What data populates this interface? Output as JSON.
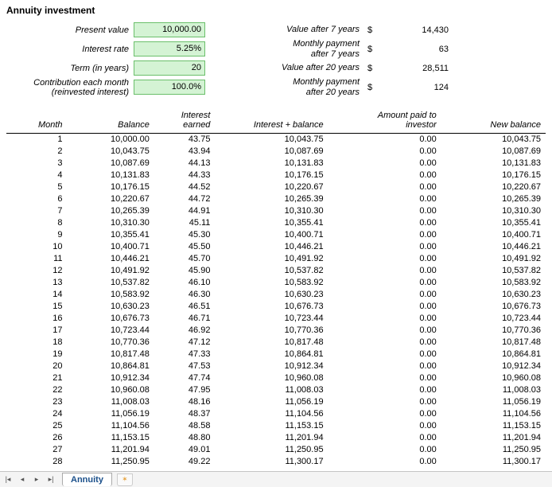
{
  "title": "Annuity investment",
  "inputs": {
    "present_value_label": "Present value",
    "present_value": "10,000.00",
    "interest_rate_label": "Interest rate",
    "interest_rate": "5.25%",
    "term_label": "Term (in years)",
    "term": "20",
    "contribution_line1": "Contribution each month",
    "contribution_line2": "(reinvested interest)",
    "contribution": "100.0%"
  },
  "outputs": {
    "value7_label": "Value after 7 years",
    "value7_cur": "$",
    "value7": "14,430",
    "pay7_line1": "Monthly payment",
    "pay7_line2": "after 7 years",
    "pay7_cur": "$",
    "pay7": "63",
    "value20_label": "Value after 20 years",
    "value20_cur": "$",
    "value20": "28,511",
    "pay20_line1": "Monthly payment",
    "pay20_line2": "after 20 years",
    "pay20_cur": "$",
    "pay20": "124"
  },
  "headers": {
    "month": "Month",
    "balance": "Balance",
    "interest_earned": "Interest earned",
    "interest_balance": "Interest + balance",
    "amount_paid": "Amount paid to investor",
    "new_balance": "New balance"
  },
  "rows": [
    {
      "m": "1",
      "b": "10,000.00",
      "ie": "43.75",
      "ib": "10,043.75",
      "ap": "0.00",
      "nb": "10,043.75"
    },
    {
      "m": "2",
      "b": "10,043.75",
      "ie": "43.94",
      "ib": "10,087.69",
      "ap": "0.00",
      "nb": "10,087.69"
    },
    {
      "m": "3",
      "b": "10,087.69",
      "ie": "44.13",
      "ib": "10,131.83",
      "ap": "0.00",
      "nb": "10,131.83"
    },
    {
      "m": "4",
      "b": "10,131.83",
      "ie": "44.33",
      "ib": "10,176.15",
      "ap": "0.00",
      "nb": "10,176.15"
    },
    {
      "m": "5",
      "b": "10,176.15",
      "ie": "44.52",
      "ib": "10,220.67",
      "ap": "0.00",
      "nb": "10,220.67"
    },
    {
      "m": "6",
      "b": "10,220.67",
      "ie": "44.72",
      "ib": "10,265.39",
      "ap": "0.00",
      "nb": "10,265.39"
    },
    {
      "m": "7",
      "b": "10,265.39",
      "ie": "44.91",
      "ib": "10,310.30",
      "ap": "0.00",
      "nb": "10,310.30"
    },
    {
      "m": "8",
      "b": "10,310.30",
      "ie": "45.11",
      "ib": "10,355.41",
      "ap": "0.00",
      "nb": "10,355.41"
    },
    {
      "m": "9",
      "b": "10,355.41",
      "ie": "45.30",
      "ib": "10,400.71",
      "ap": "0.00",
      "nb": "10,400.71"
    },
    {
      "m": "10",
      "b": "10,400.71",
      "ie": "45.50",
      "ib": "10,446.21",
      "ap": "0.00",
      "nb": "10,446.21"
    },
    {
      "m": "11",
      "b": "10,446.21",
      "ie": "45.70",
      "ib": "10,491.92",
      "ap": "0.00",
      "nb": "10,491.92"
    },
    {
      "m": "12",
      "b": "10,491.92",
      "ie": "45.90",
      "ib": "10,537.82",
      "ap": "0.00",
      "nb": "10,537.82"
    },
    {
      "m": "13",
      "b": "10,537.82",
      "ie": "46.10",
      "ib": "10,583.92",
      "ap": "0.00",
      "nb": "10,583.92"
    },
    {
      "m": "14",
      "b": "10,583.92",
      "ie": "46.30",
      "ib": "10,630.23",
      "ap": "0.00",
      "nb": "10,630.23"
    },
    {
      "m": "15",
      "b": "10,630.23",
      "ie": "46.51",
      "ib": "10,676.73",
      "ap": "0.00",
      "nb": "10,676.73"
    },
    {
      "m": "16",
      "b": "10,676.73",
      "ie": "46.71",
      "ib": "10,723.44",
      "ap": "0.00",
      "nb": "10,723.44"
    },
    {
      "m": "17",
      "b": "10,723.44",
      "ie": "46.92",
      "ib": "10,770.36",
      "ap": "0.00",
      "nb": "10,770.36"
    },
    {
      "m": "18",
      "b": "10,770.36",
      "ie": "47.12",
      "ib": "10,817.48",
      "ap": "0.00",
      "nb": "10,817.48"
    },
    {
      "m": "19",
      "b": "10,817.48",
      "ie": "47.33",
      "ib": "10,864.81",
      "ap": "0.00",
      "nb": "10,864.81"
    },
    {
      "m": "20",
      "b": "10,864.81",
      "ie": "47.53",
      "ib": "10,912.34",
      "ap": "0.00",
      "nb": "10,912.34"
    },
    {
      "m": "21",
      "b": "10,912.34",
      "ie": "47.74",
      "ib": "10,960.08",
      "ap": "0.00",
      "nb": "10,960.08"
    },
    {
      "m": "22",
      "b": "10,960.08",
      "ie": "47.95",
      "ib": "11,008.03",
      "ap": "0.00",
      "nb": "11,008.03"
    },
    {
      "m": "23",
      "b": "11,008.03",
      "ie": "48.16",
      "ib": "11,056.19",
      "ap": "0.00",
      "nb": "11,056.19"
    },
    {
      "m": "24",
      "b": "11,056.19",
      "ie": "48.37",
      "ib": "11,104.56",
      "ap": "0.00",
      "nb": "11,104.56"
    },
    {
      "m": "25",
      "b": "11,104.56",
      "ie": "48.58",
      "ib": "11,153.15",
      "ap": "0.00",
      "nb": "11,153.15"
    },
    {
      "m": "26",
      "b": "11,153.15",
      "ie": "48.80",
      "ib": "11,201.94",
      "ap": "0.00",
      "nb": "11,201.94"
    },
    {
      "m": "27",
      "b": "11,201.94",
      "ie": "49.01",
      "ib": "11,250.95",
      "ap": "0.00",
      "nb": "11,250.95"
    },
    {
      "m": "28",
      "b": "11,250.95",
      "ie": "49.22",
      "ib": "11,300.17",
      "ap": "0.00",
      "nb": "11,300.17"
    }
  ],
  "tab": {
    "name": "Annuity"
  }
}
